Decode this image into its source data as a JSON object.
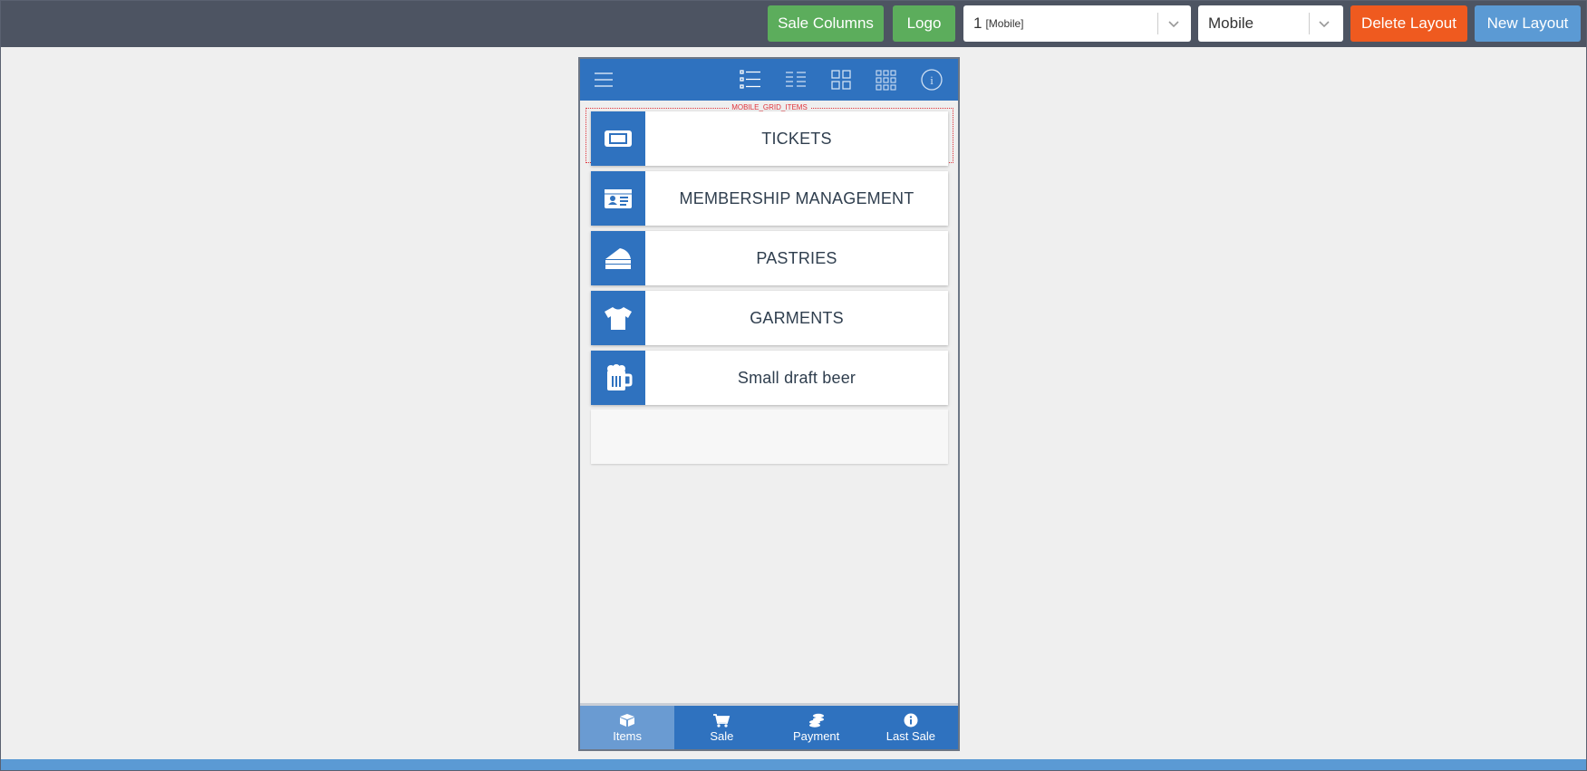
{
  "toolbar": {
    "sale_columns_label": "Sale Columns",
    "logo_label": "Logo",
    "layout_select": {
      "value": "1",
      "suffix": "[Mobile]"
    },
    "device_select": {
      "value": "Mobile"
    },
    "delete_layout_label": "Delete Layout",
    "new_layout_label": "New Layout"
  },
  "device": {
    "header_icons": [
      "menu-icon",
      "list-detail-icon",
      "list-compact-icon",
      "grid-large-icon",
      "grid-small-icon",
      "info-icon"
    ],
    "grid_tag": "MOBILE_GRID_ITEMS",
    "items": [
      {
        "label": "TICKETS",
        "icon": "ticket-icon"
      },
      {
        "label": "MEMBERSHIP MANAGEMENT",
        "icon": "id-card-icon"
      },
      {
        "label": "PASTRIES",
        "icon": "cake-icon"
      },
      {
        "label": "GARMENTS",
        "icon": "tshirt-icon"
      },
      {
        "label": "Small draft beer",
        "icon": "beer-mug-icon"
      }
    ],
    "tabs": [
      {
        "label": "Items",
        "icon": "box-icon",
        "active": true
      },
      {
        "label": "Sale",
        "icon": "cart-icon",
        "active": false
      },
      {
        "label": "Payment",
        "icon": "coins-icon",
        "active": false
      },
      {
        "label": "Last Sale",
        "icon": "info-icon",
        "active": false
      }
    ]
  },
  "colors": {
    "topbar": "#4d5462",
    "green": "#5cad5c",
    "orange": "#ef5a1f",
    "blue": "#5b9ad4",
    "primary": "#2f72bf"
  }
}
